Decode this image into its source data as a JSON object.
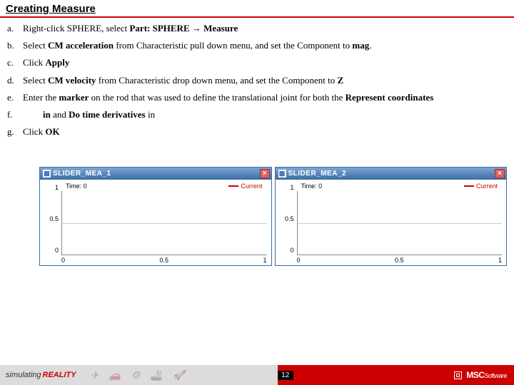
{
  "header": {
    "title": "Creating Measure"
  },
  "steps": [
    {
      "letter": "a.",
      "html": "Right-click SPHERE, select <b>Part: SPHERE → Measure</b>"
    },
    {
      "letter": "b.",
      "html": "Select <b>CM acceleration</b> from Characteristic pull down menu, and set the Component to <b>mag</b>."
    },
    {
      "letter": "c.",
      "html": "Click <b>Apply</b>"
    },
    {
      "letter": "d.",
      "html": "Select <b>CM velocity</b> from Characteristic drop down menu, and set the Component to <b>Z</b>"
    },
    {
      "letter": "e.",
      "html": "Enter the <b>marker</b> on the rod that was used to define the translational joint for both the <b>Represent coordinates</b>"
    },
    {
      "letter": "f.",
      "html": "<b>in</b> and <b>Do time derivatives</b> in",
      "indent": true
    },
    {
      "letter": "g.",
      "html": "Click <b>OK</b>"
    }
  ],
  "footer": {
    "tagline_sim": "simulating",
    "tagline_real": "REALITY",
    "page": "12",
    "brand_main": "MSC",
    "brand_sub": "Software"
  },
  "chart_data": [
    {
      "type": "line",
      "title": "SLIDER_MEA_1",
      "time_label": "Time: 0",
      "legend": "Current",
      "x": [
        0.0,
        0.5,
        1.0
      ],
      "y_ticks": [
        1.0,
        0.5,
        0.0
      ],
      "series": [
        {
          "name": "Current",
          "values": []
        }
      ],
      "xlim": [
        0.0,
        1.0
      ],
      "ylim": [
        0.0,
        1.0
      ]
    },
    {
      "type": "line",
      "title": "SLIDER_MEA_2",
      "time_label": "Time: 0",
      "legend": "Current",
      "x": [
        0.0,
        0.5,
        1.0
      ],
      "y_ticks": [
        1.0,
        0.5,
        0.0
      ],
      "series": [
        {
          "name": "Current",
          "values": []
        }
      ],
      "xlim": [
        0.0,
        1.0
      ],
      "ylim": [
        0.0,
        1.0
      ]
    }
  ]
}
